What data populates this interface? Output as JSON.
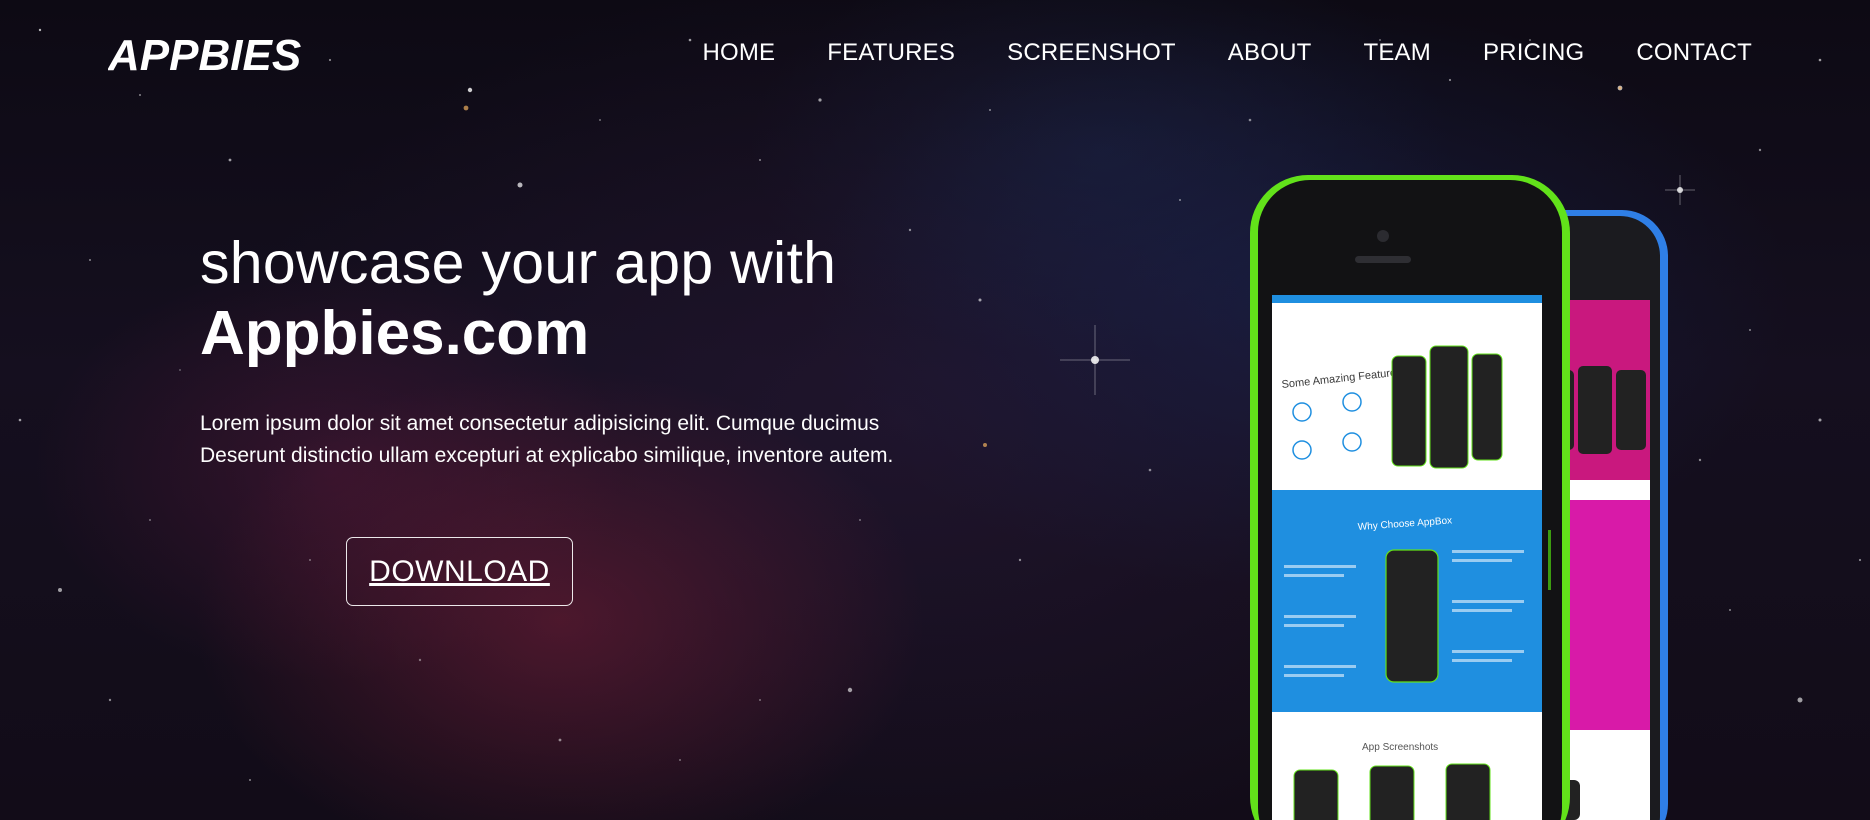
{
  "brand": {
    "logo_text": "APPBIES"
  },
  "nav": {
    "items": [
      {
        "label": "HOME"
      },
      {
        "label": "FEATURES"
      },
      {
        "label": "SCREENSHOT"
      },
      {
        "label": "ABOUT"
      },
      {
        "label": "TEAM"
      },
      {
        "label": "PRICING"
      },
      {
        "label": "CONTACT"
      }
    ]
  },
  "hero": {
    "tagline": "showcase your app with",
    "site_name": "Appbies.com",
    "description_line1": "Lorem ipsum dolor sit amet consectetur adipisicing elit. Cumque ducimus",
    "description_line2": "Deserunt distinctio ullam excepturi at explicabo similique, inventore autem.",
    "cta_label": "DOWNLOAD"
  },
  "mockup": {
    "front_screen": {
      "section1_title": "Some Amazing Features",
      "section2_title": "Why Choose AppBox",
      "section3_title": "App Screenshots"
    },
    "colors": {
      "front_phone": "#62e21a",
      "back_phone": "#2f7fe6",
      "front_screen_accent": "#1f8fe0",
      "back_screen_accent": "#d81aa8"
    }
  }
}
